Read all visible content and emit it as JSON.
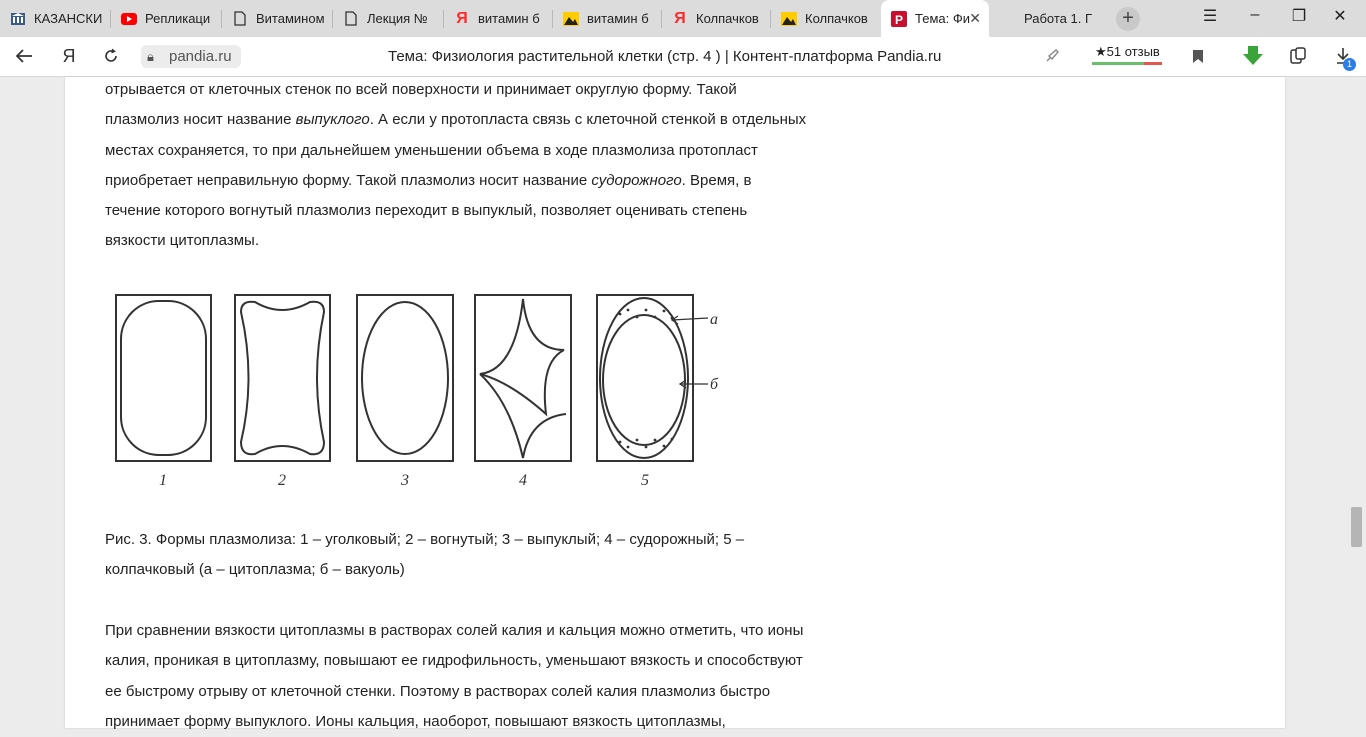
{
  "browser": {
    "tabs": [
      {
        "label": "КАЗАНСКИ",
        "icon": "university-icon"
      },
      {
        "label": "Репликаци",
        "icon": "youtube-icon"
      },
      {
        "label": "Витамином",
        "icon": "document-icon"
      },
      {
        "label": "Лекция №",
        "icon": "document-icon"
      },
      {
        "label": "витамин б",
        "icon": "yandex-icon"
      },
      {
        "label": "витамин б",
        "icon": "image-search-icon"
      },
      {
        "label": "Колпачков",
        "icon": "yandex-icon"
      },
      {
        "label": "Колпачков",
        "icon": "image-search-icon"
      },
      {
        "label": "Тема: Фи",
        "icon": "pandia-icon",
        "active": true
      },
      {
        "label": "Работа 1. Г",
        "icon": ""
      }
    ],
    "address": {
      "url": "pandia.ru",
      "page_title": "Тема: Физиология растительной клетки (стр. 4 ) | Контент-платформа Pandia.ru",
      "reviews": "★51 отзыв",
      "downloads_badge": "1"
    }
  },
  "article": {
    "p1_lines": [
      "отрывается от клеточных стенок по всей поверхности и принимает округлую форму. Такой",
      "плазмолиз носит название ",
      "выпуклого",
      ". А если у протопласта связь с клеточной стенкой в отдельных",
      "местах сохраняется, то при дальнейшем уменьшении объема в ходе плазмолиза протопласт",
      "приобретает неправильную форму. Такой плазмолиз носит название ",
      "судорожного",
      ". Время, в",
      "течение которого вогнутый плазмолиз переходит в выпуклый, позволяет оценивать степень",
      "вязкости цитоплазмы."
    ],
    "figure_labels": {
      "n1": "1",
      "n2": "2",
      "n3": "3",
      "n4": "4",
      "n5": "5",
      "a": "а",
      "b": "б"
    },
    "caption_lines": [
      "Рис. 3. Формы плазмолиза: 1 – уголковый; 2 – вогнутый; 3 – выпуклый; 4 – судорожный; 5 –",
      "колпачковый (а – цитоплазма; б – вакуоль)"
    ],
    "p2_lines": [
      "При сравнении вязкости цитоплазмы в растворах солей калия и кальция можно отметить, что ионы",
      "калия, проникая в цитоплазму, повышают ее гидрофильность, уменьшают вязкость и способствуют",
      "ее быстрому отрыву от клеточной стенки. Поэтому в растворах солей калия плазмолиз быстро",
      "принимает форму выпуклого. Ионы кальция, наоборот, повышают вязкость цитоплазмы,"
    ]
  }
}
